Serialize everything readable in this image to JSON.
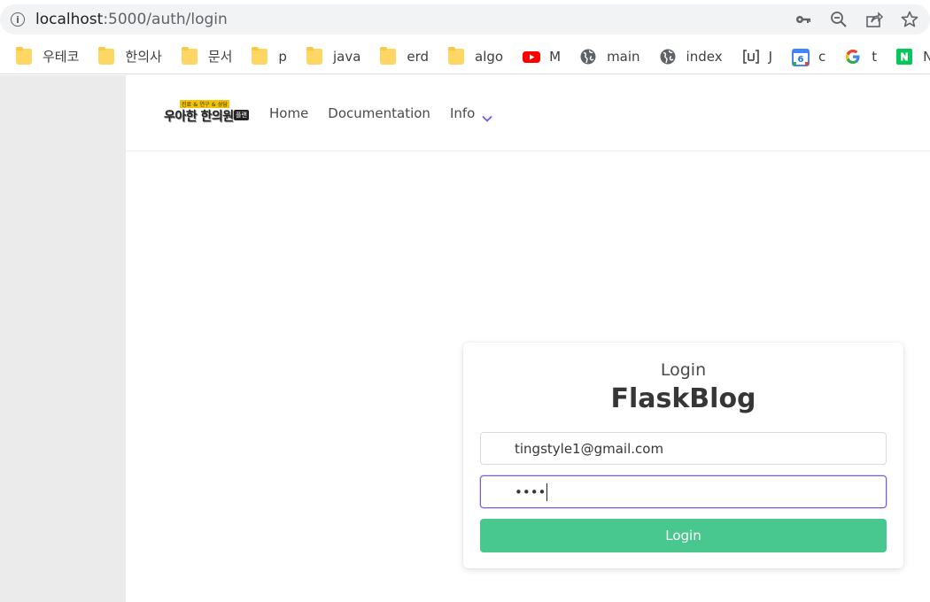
{
  "browser": {
    "url_host": "localhost",
    "url_path": ":5000/auth/login",
    "icons": [
      "info-icon",
      "key-icon",
      "zoom-out-icon",
      "share-icon",
      "star-icon"
    ]
  },
  "bookmarks": [
    {
      "label": "우테코",
      "icon": "folder-icon"
    },
    {
      "label": "한의사",
      "icon": "folder-icon"
    },
    {
      "label": "문서",
      "icon": "folder-icon"
    },
    {
      "label": "p",
      "icon": "folder-icon"
    },
    {
      "label": "java",
      "icon": "folder-icon"
    },
    {
      "label": "erd",
      "icon": "folder-icon"
    },
    {
      "label": "algo",
      "icon": "folder-icon"
    },
    {
      "label": "M",
      "icon": "youtube-icon"
    },
    {
      "label": "main",
      "icon": "globe-icon"
    },
    {
      "label": "index",
      "icon": "globe-icon"
    },
    {
      "label": "J",
      "icon": "bracket-icon"
    },
    {
      "label": "c",
      "icon": "calendar-icon"
    },
    {
      "label": "t",
      "icon": "google-icon"
    },
    {
      "label": "N",
      "icon": "naver-icon"
    }
  ],
  "navbar": {
    "logo_small_text": "진료 & 연구 & 상담",
    "logo_main_text": "우아한 한의원",
    "logo_tag_text": "플랜",
    "links": {
      "home": "Home",
      "docs": "Documentation",
      "info": "Info"
    }
  },
  "login": {
    "subtitle": "Login",
    "title": "FlaskBlog",
    "email_value": "tingstyle1@gmail.com",
    "password_mask": "••••",
    "button_label": "Login"
  },
  "colors": {
    "accent": "#7957d5",
    "button": "#48c78e",
    "gutter": "#ebebeb"
  }
}
